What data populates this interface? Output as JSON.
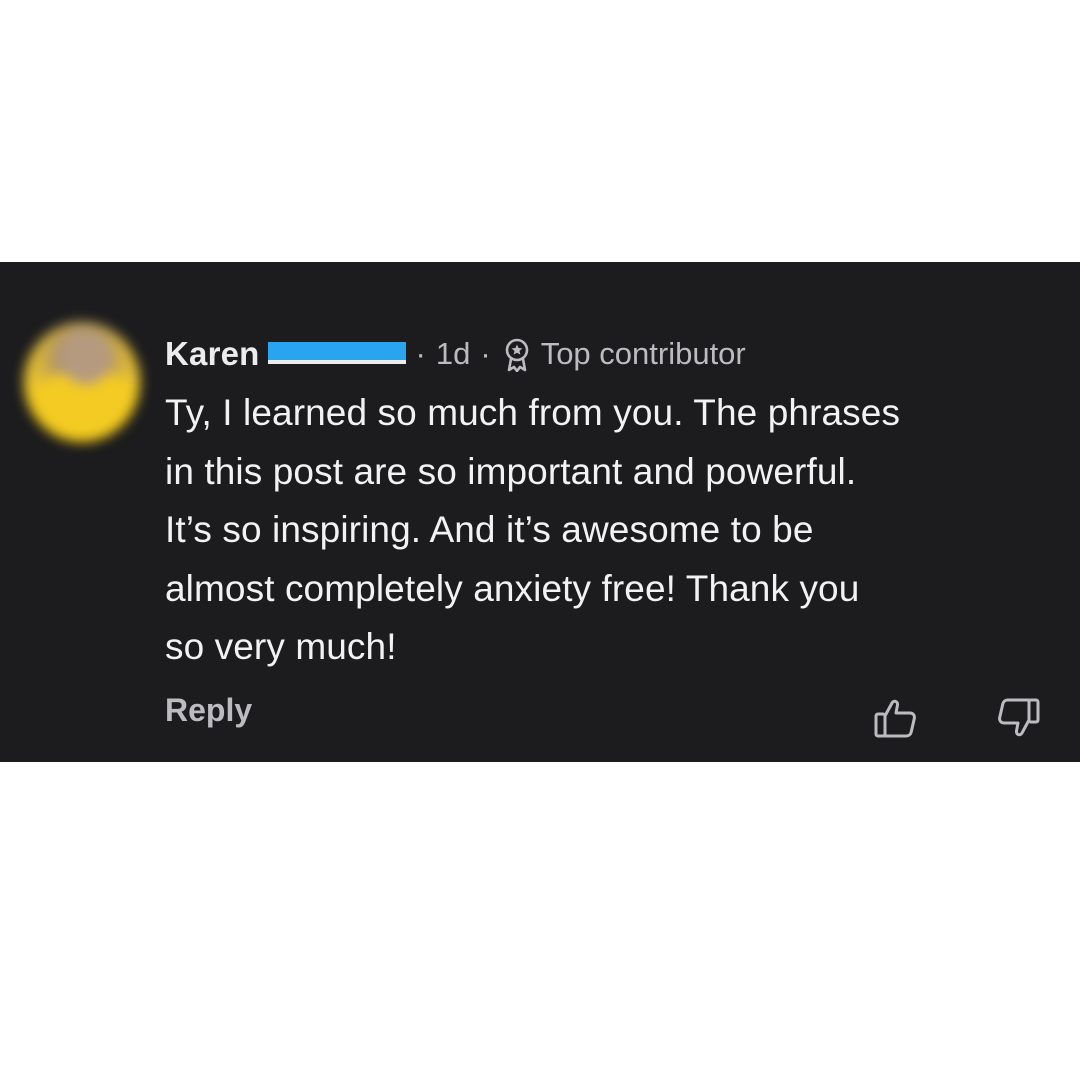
{
  "comment": {
    "author_first_name": "Karen",
    "timestamp": "1d",
    "separator": "·",
    "badge": {
      "icon": "award-ribbon-icon",
      "label": "Top contributor"
    },
    "body_lines": [
      "Ty, I learned so much from you. The phrases",
      "in this post are so important and powerful.",
      "It’s so inspiring. And it’s awesome to be",
      "almost completely anxiety free! Thank you",
      "so very much!"
    ],
    "actions": {
      "reply_label": "Reply",
      "like_icon": "thumbs-up-icon",
      "dislike_icon": "thumbs-down-icon"
    }
  },
  "colors": {
    "card_background": "#1c1c1e",
    "page_background": "#ffffff",
    "primary_text": "#f2f2f4",
    "secondary_text": "#bcbcc0",
    "redaction": "#29a5f0"
  }
}
